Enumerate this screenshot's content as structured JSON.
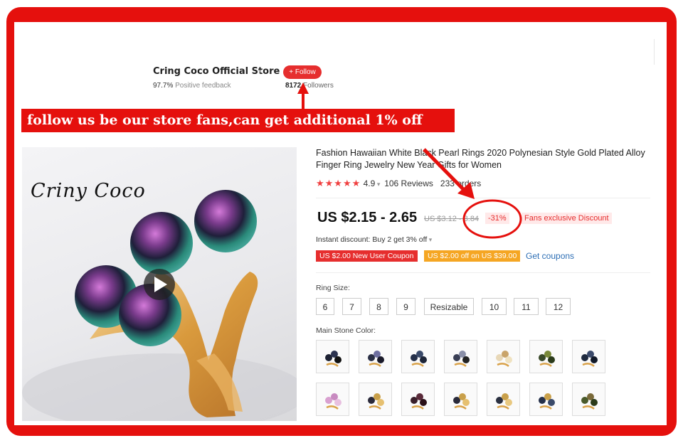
{
  "store": {
    "name": "Cring Coco Official Store",
    "feedback_value": "97.7%",
    "feedback_label": "Positive feedback",
    "follow_label": "+ Follow",
    "followers_count": "8172",
    "followers_label": "Followers"
  },
  "banner": "follow us be our store fans,can get additional 1% off",
  "image": {
    "logo_text": "Criny Coco"
  },
  "product": {
    "title": "Fashion Hawaiian White Black Pearl Rings 2020 Polynesian Style Gold Plated Alloy Finger Ring Jewelry New Year Gifts for Women",
    "stars": "★★★★★",
    "rating": "4.9",
    "reviews": "106 Reviews",
    "orders": "233 orders",
    "price": "US $2.15 - 2.65",
    "old_price": "US $3.12 - 3.84",
    "discount": "-31%",
    "fans_discount": "Fans exclusive Discount",
    "instant_discount": "Instant discount: Buy 2 get 3% off",
    "coupon1": "US $2.00 New User Coupon",
    "coupon2": "US $2.00 off on US $39.00",
    "get_coupons": "Get coupons"
  },
  "ring_size": {
    "label": "Ring Size:",
    "options": [
      "6",
      "7",
      "8",
      "9",
      "Resizable",
      "10",
      "11",
      "12"
    ]
  },
  "main_stone_color": {
    "label": "Main Stone Color:"
  },
  "colors": {
    "accent_red": "#e5100d",
    "brand_red": "#e62e2e",
    "coupon_orange": "#f5a623",
    "link_blue": "#2e6fb5"
  }
}
